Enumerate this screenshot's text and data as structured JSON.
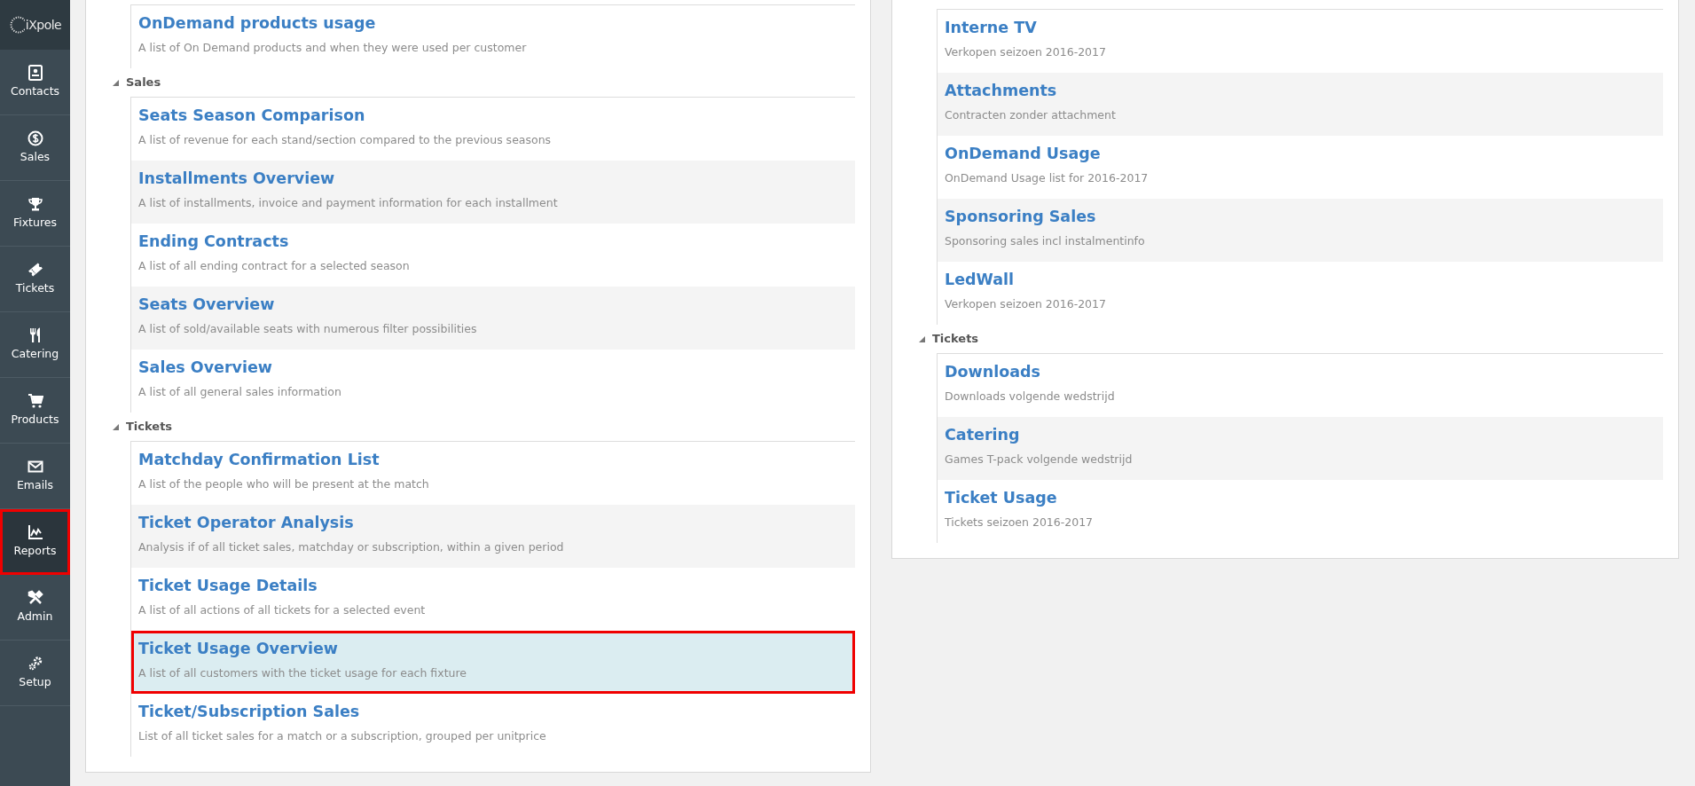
{
  "sidebar": {
    "logo": "iXpole",
    "items": [
      {
        "label": "Contacts",
        "selected": false
      },
      {
        "label": "Sales",
        "selected": false
      },
      {
        "label": "Fixtures",
        "selected": false
      },
      {
        "label": "Tickets",
        "selected": false
      },
      {
        "label": "Catering",
        "selected": false
      },
      {
        "label": "Products",
        "selected": false
      },
      {
        "label": "Emails",
        "selected": false
      },
      {
        "label": "Reports",
        "selected": true
      },
      {
        "label": "Admin",
        "selected": false
      },
      {
        "label": "Setup",
        "selected": false
      }
    ]
  },
  "panels": [
    {
      "groups": [
        {
          "items": [
            {
              "title": "OnDemand products usage",
              "description": "A list of On Demand products and when they were used per customer",
              "selected": false
            }
          ]
        },
        {
          "header": "Sales",
          "items": [
            {
              "title": "Seats Season Comparison",
              "description": "A list of revenue for each stand/section compared to the previous seasons",
              "selected": false
            },
            {
              "title": "Installments Overview",
              "description": "A list of installments, invoice and payment information for each installment",
              "selected": false
            },
            {
              "title": "Ending Contracts",
              "description": "A list of all ending contract for a selected season",
              "selected": false
            },
            {
              "title": "Seats Overview",
              "description": "A list of sold/available seats with numerous filter possibilities",
              "selected": false
            },
            {
              "title": "Sales Overview",
              "description": "A list of all general sales information",
              "selected": false
            }
          ]
        },
        {
          "header": "Tickets",
          "items": [
            {
              "title": "Matchday Confirmation List",
              "description": "A list of the people who will be present at the match",
              "selected": false
            },
            {
              "title": "Ticket Operator Analysis",
              "description": "Analysis if of all ticket sales, matchday or subscription, within a given period",
              "selected": false
            },
            {
              "title": "Ticket Usage Details",
              "description": "A list of all actions of all tickets for a selected event",
              "selected": false
            },
            {
              "title": "Ticket Usage Overview",
              "description": "A list of all customers with the ticket usage for each fixture",
              "selected": true
            },
            {
              "title": "Ticket/Subscription Sales",
              "description": "List of all ticket sales for a match or a subscription, grouped per unitprice",
              "selected": false
            }
          ]
        }
      ]
    },
    {
      "groups": [
        {
          "items": [
            {
              "title": "Interne TV",
              "description": "Verkopen seizoen 2016-2017",
              "selected": false
            },
            {
              "title": "Attachments",
              "description": "Contracten zonder attachment",
              "selected": false
            },
            {
              "title": "OnDemand Usage",
              "description": "OnDemand Usage list for 2016-2017",
              "selected": false
            },
            {
              "title": "Sponsoring Sales",
              "description": "Sponsoring sales incl instalmentinfo",
              "selected": false
            },
            {
              "title": "LedWall",
              "description": "Verkopen seizoen 2016-2017",
              "selected": false
            }
          ]
        },
        {
          "header": "Tickets",
          "items": [
            {
              "title": "Downloads",
              "description": "Downloads volgende wedstrijd",
              "selected": false
            },
            {
              "title": "Catering",
              "description": "Games T-pack volgende wedstrijd",
              "selected": false
            },
            {
              "title": "Ticket Usage",
              "description": "Tickets seizoen 2016-2017",
              "selected": false
            }
          ]
        }
      ]
    }
  ]
}
